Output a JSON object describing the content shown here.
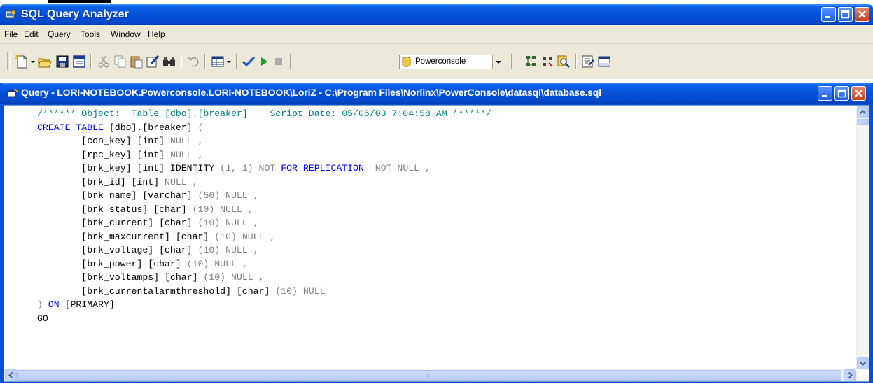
{
  "app": {
    "title": "SQL Query Analyzer"
  },
  "menu": [
    "File",
    "Edit",
    "Query",
    "Tools",
    "Window",
    "Help"
  ],
  "toolbar": {
    "database": "Powerconsole",
    "icons": [
      "new-query-icon",
      "dropdown-arrow-icon",
      "open-icon",
      "save-icon",
      "load-script-icon",
      "cut-icon",
      "copy-icon",
      "paste-icon",
      "clear-window-icon",
      "find-icon",
      "undo-icon",
      "results-grid-icon",
      "dropdown-arrow-icon",
      "parse-check-icon",
      "execute-icon",
      "cancel-query-icon",
      "database-icon",
      "estimated-plan-icon",
      "object-browser-icon",
      "object-search-icon",
      "current-connection-properties-icon",
      "show-results-pane-icon"
    ]
  },
  "query_window": {
    "title": "Query - LORI-NOTEBOOK.Powerconsole.LORI-NOTEBOOK\\LoriZ - C:\\Program Files\\Norlinx\\PowerConsole\\datasql\\database.sql"
  },
  "editor": {
    "lines": [
      [
        [
          "c",
          "/****** Object:  Table [dbo].[breaker]    Script Date: 05/06/03 7:04:58 AM ******/"
        ]
      ],
      [
        [
          "k",
          "CREATE TABLE "
        ],
        [
          "t",
          "[dbo].[breaker] "
        ],
        [
          "n",
          "("
        ]
      ],
      [
        [
          "t",
          "\t[con_key] [int] "
        ],
        [
          "n",
          "NULL ,"
        ]
      ],
      [
        [
          "t",
          "\t[rpc_key] [int] "
        ],
        [
          "n",
          "NULL ,"
        ]
      ],
      [
        [
          "t",
          "\t[brk_key] [int] IDENTITY "
        ],
        [
          "n",
          "(1, 1) NOT "
        ],
        [
          "k",
          "FOR REPLICATION"
        ],
        [
          "n",
          "  NOT NULL ,"
        ]
      ],
      [
        [
          "t",
          "\t[brk_id] [int] "
        ],
        [
          "n",
          "NULL ,"
        ]
      ],
      [
        [
          "t",
          "\t[brk_name] [varchar] "
        ],
        [
          "n",
          "(50) NULL ,"
        ]
      ],
      [
        [
          "t",
          "\t[brk_status] [char] "
        ],
        [
          "n",
          "(10) NULL ,"
        ]
      ],
      [
        [
          "t",
          "\t[brk_current] [char] "
        ],
        [
          "n",
          "(10) NULL ,"
        ]
      ],
      [
        [
          "t",
          "\t[brk_maxcurrent] [char] "
        ],
        [
          "n",
          "(10) NULL ,"
        ]
      ],
      [
        [
          "t",
          "\t[brk_voltage] [char] "
        ],
        [
          "n",
          "(10) NULL ,"
        ]
      ],
      [
        [
          "t",
          "\t[brk_power] [char] "
        ],
        [
          "n",
          "(10) NULL ,"
        ]
      ],
      [
        [
          "t",
          "\t[brk_voltamps] [char] "
        ],
        [
          "n",
          "(10) NULL ,"
        ]
      ],
      [
        [
          "t",
          "\t[brk_currentalarmthreshold] [char] "
        ],
        [
          "n",
          "(10) NULL"
        ]
      ],
      [
        [
          "n",
          ") "
        ],
        [
          "k",
          "ON "
        ],
        [
          "t",
          "[PRIMARY]"
        ]
      ],
      [
        [
          "t",
          "GO"
        ]
      ]
    ]
  },
  "colors": {
    "titlebar": "#0451d8",
    "comment": "#008080",
    "keyword": "#0000ff",
    "null": "#808080",
    "chrome": "#ece9d8"
  }
}
